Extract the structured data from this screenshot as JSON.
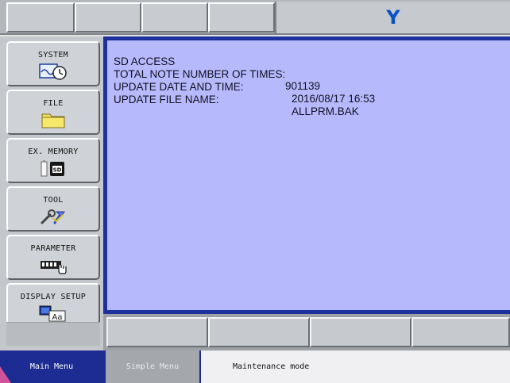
{
  "top_bar": {
    "title": "Y"
  },
  "sidebar": {
    "items": [
      {
        "label": "SYSTEM",
        "icon": "system-clock-icon"
      },
      {
        "label": "FILE",
        "icon": "folder-icon"
      },
      {
        "label": "EX. MEMORY",
        "icon": "sd-card-icon"
      },
      {
        "label": "TOOL",
        "icon": "tool-wrench-icon"
      },
      {
        "label": "PARAMETER",
        "icon": "parameter-switch-icon"
      },
      {
        "label": "DISPLAY SETUP",
        "icon": "display-font-icon"
      }
    ]
  },
  "main": {
    "title": "SD ACCESS",
    "rows": [
      {
        "label": "TOTAL NOTE NUMBER OF TIMES:",
        "value": "901139"
      },
      {
        "label": "UPDATE DATE AND TIME:",
        "value": "2016/08/17 16:53"
      },
      {
        "label": "UPDATE FILE NAME:",
        "value": "ALLPRM.BAK"
      }
    ]
  },
  "status_bar": {
    "main_menu": "Main Menu",
    "simple_menu": "Simple Menu",
    "mode": "Maintenance mode"
  },
  "colors": {
    "accent": "#1c2c92",
    "panel_bg": "#b6bafc",
    "title_y": "#0a52c8"
  }
}
